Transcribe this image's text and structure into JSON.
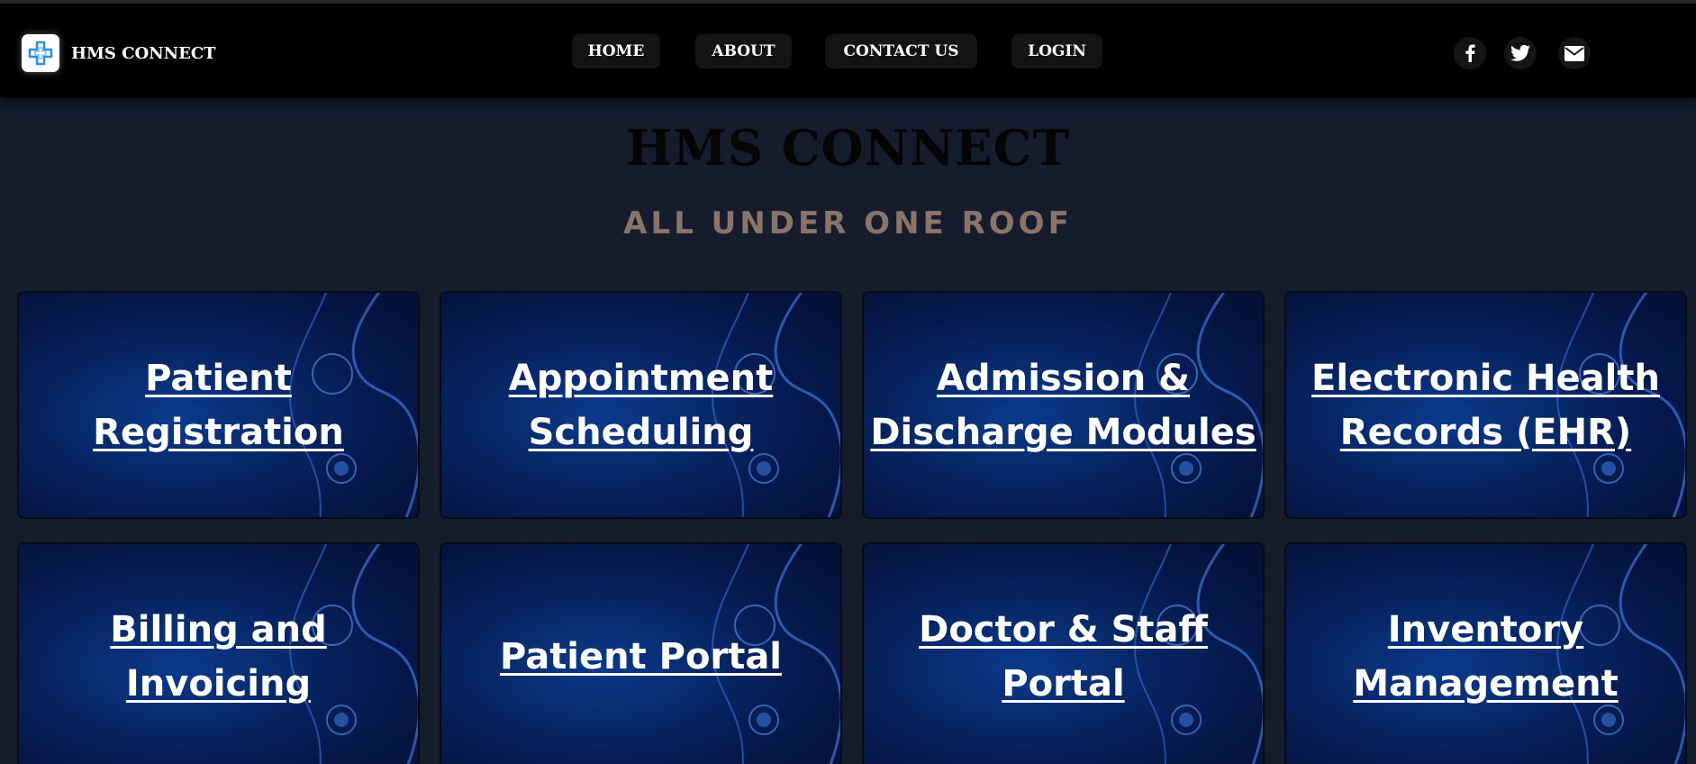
{
  "brand": {
    "name": "HMS CONNECT",
    "logo_icon": "medical-cross-icon"
  },
  "nav": {
    "items": [
      "HOME",
      "ABOUT",
      "CONTACT US",
      "LOGIN"
    ]
  },
  "social": [
    "facebook-icon",
    "twitter-icon",
    "envelope-icon"
  ],
  "hero": {
    "title": "HMS CONNECT",
    "subtitle": "ALL UNDER ONE ROOF"
  },
  "cards": [
    "Patient Registration",
    "Appointment Scheduling",
    "Admission & Discharge Modules",
    "Electronic Health Records (EHR)",
    "Billing and Invoicing",
    "Patient Portal",
    "Doctor & Staff Portal",
    "Inventory Management"
  ],
  "colors": {
    "background": "#151c2b",
    "navbar": "#000000",
    "card_blue": "#082a6b",
    "subtitle": "#8a7468"
  }
}
